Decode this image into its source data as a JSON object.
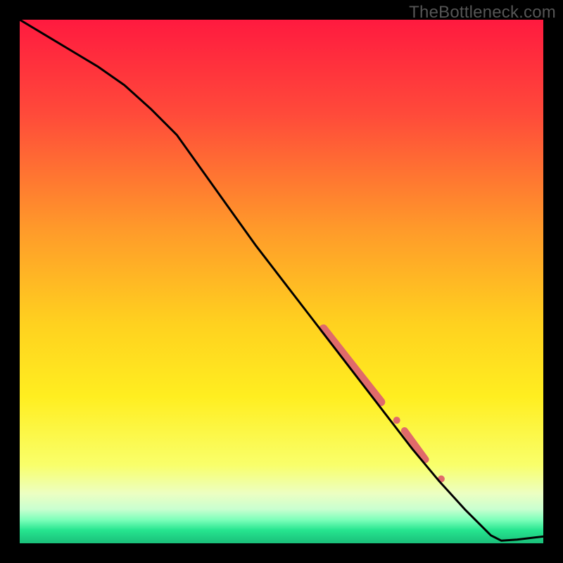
{
  "watermark": "TheBottleneck.com",
  "chart_data": {
    "type": "line",
    "title": "",
    "xlabel": "",
    "ylabel": "",
    "xlim": [
      0,
      100
    ],
    "ylim": [
      0,
      100
    ],
    "grid": false,
    "series": [
      {
        "name": "curve",
        "x": [
          0,
          5,
          10,
          15,
          20,
          25,
          30,
          35,
          40,
          45,
          50,
          55,
          60,
          65,
          70,
          75,
          80,
          85,
          90,
          92,
          95,
          100
        ],
        "y": [
          100,
          97,
          94,
          91,
          87.5,
          83,
          78,
          71,
          64,
          57,
          50.5,
          44,
          37.5,
          31,
          24.5,
          18,
          12,
          6.5,
          1.5,
          0.5,
          0.7,
          1.3
        ]
      }
    ],
    "highlights": [
      {
        "name": "segment-a",
        "x": [
          58,
          69
        ],
        "y": [
          41,
          27
        ],
        "color": "#e06a6a",
        "width": 12
      },
      {
        "name": "dot-a",
        "x": [
          72
        ],
        "y": [
          23.5
        ],
        "color": "#e06a6a",
        "r": 5
      },
      {
        "name": "segment-b",
        "x": [
          73.5,
          77.5
        ],
        "y": [
          21.5,
          16
        ],
        "color": "#e06a6a",
        "width": 10
      },
      {
        "name": "dot-b",
        "x": [
          80.5
        ],
        "y": [
          12.3
        ],
        "color": "#e06a6a",
        "r": 5
      }
    ],
    "gradient_stops": [
      {
        "offset": 0.0,
        "color": "#ff1a3f"
      },
      {
        "offset": 0.18,
        "color": "#ff4a3a"
      },
      {
        "offset": 0.4,
        "color": "#ff9a2a"
      },
      {
        "offset": 0.58,
        "color": "#ffd11f"
      },
      {
        "offset": 0.72,
        "color": "#ffee20"
      },
      {
        "offset": 0.85,
        "color": "#f9ff6a"
      },
      {
        "offset": 0.905,
        "color": "#ecffc2"
      },
      {
        "offset": 0.935,
        "color": "#c9ffd0"
      },
      {
        "offset": 0.955,
        "color": "#7dffba"
      },
      {
        "offset": 0.975,
        "color": "#26e58f"
      },
      {
        "offset": 1.0,
        "color": "#1abf7a"
      }
    ]
  }
}
